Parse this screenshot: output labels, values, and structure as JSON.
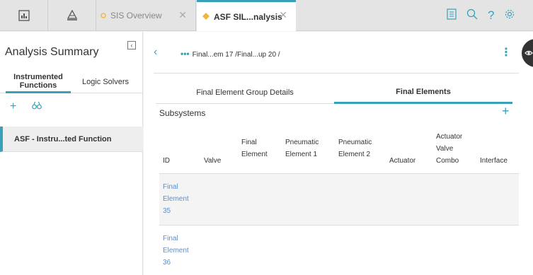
{
  "topbar": {
    "icons": [
      "dashboard-icon",
      "hierarchy-icon"
    ],
    "tabs": [
      {
        "label": "SIS Overview",
        "active": false
      },
      {
        "label": "ASF SIL...nalysis",
        "active": true
      }
    ],
    "right_icons": [
      "document-icon",
      "search-icon",
      "help-icon",
      "settings-icon"
    ]
  },
  "left": {
    "title": "Analysis Summary",
    "tabs": [
      "Instrumented Functions",
      "Logic Solvers"
    ],
    "items": [
      "ASF - Instru...ted Function"
    ]
  },
  "main": {
    "breadcrumb": "Final...em 17 /Final...up 20 /",
    "tabs": [
      "Final Element Group Details",
      "Final Elements"
    ],
    "section_title": "Subsystems",
    "columns": [
      "ID",
      "Valve",
      "Final Element",
      "Pneumatic Element 1",
      "Pneumatic Element 2",
      "Actuator",
      "Actuator Valve Combo",
      "Interface"
    ],
    "rows": [
      {
        "id": "Final Element 35"
      },
      {
        "id": "Final Element 36"
      }
    ]
  },
  "colors": {
    "accent": "#3aa0b8",
    "link": "#5a8fcf",
    "tab_dot": "#f3b33d"
  }
}
